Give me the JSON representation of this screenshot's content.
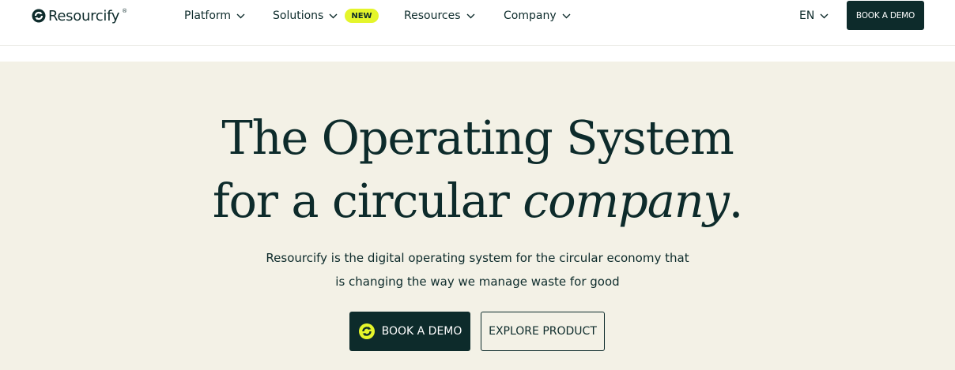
{
  "nav": {
    "logo_text": "Resourcify",
    "logo_reg": "®",
    "items": [
      {
        "label": "Platform"
      },
      {
        "label": "Solutions",
        "badge": "NEW"
      },
      {
        "label": "Resources"
      },
      {
        "label": "Company"
      }
    ],
    "language": "EN",
    "demo_button": "BOOK A DEMO"
  },
  "hero": {
    "headline_line1": "The Operating System",
    "headline_line2_prefix": "for a circular ",
    "headline_line2_emphasis": "company",
    "headline_line2_suffix": ".",
    "subtitle_line1": "Resourcify is the digital operating system for the circular economy that",
    "subtitle_line2": "is changing the way we manage waste for good",
    "primary_button": "BOOK A DEMO",
    "secondary_button": "EXPLORE PRODUCT"
  },
  "colors": {
    "brand_dark": "#0d2b2b",
    "hero_background": "#f3f1e6",
    "accent_lime": "#e4f52b"
  },
  "icons": {
    "logo": "recycle-logo-icon",
    "dropdown": "chevron-down-icon",
    "button": "recycle-arrows-icon"
  }
}
